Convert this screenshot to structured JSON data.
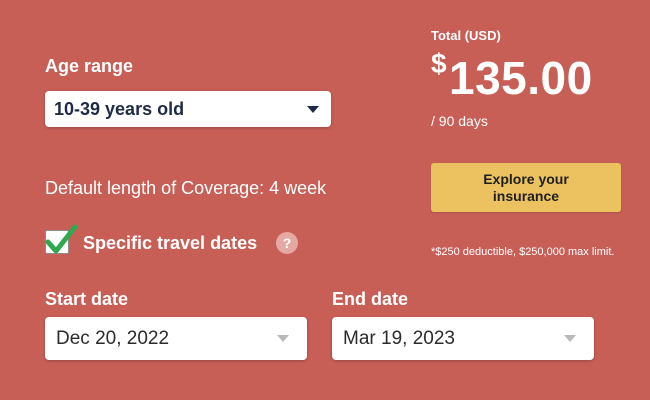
{
  "age_range": {
    "label": "Age range",
    "selected": "10-39 years old"
  },
  "coverage": {
    "text": "Default length of Coverage: 4 week"
  },
  "specific_dates": {
    "label": "Specific travel dates",
    "checked": true,
    "help_icon": "?"
  },
  "start_date": {
    "label": "Start date",
    "value": "Dec 20, 2022"
  },
  "end_date": {
    "label": "End date",
    "value": "Mar 19, 2023"
  },
  "total": {
    "label": "Total (USD)",
    "currency_symbol": "$",
    "amount": "135.00",
    "period": "/ 90 days"
  },
  "explore_button": {
    "label": "Explore your insurance"
  },
  "footnote": {
    "text": "*$250 deductible, $250,000 max limit."
  },
  "colors": {
    "background": "#c85f57",
    "button": "#ecc15f",
    "check": "#2fa84f"
  },
  "icons": [
    "chevron-down-icon",
    "checkmark-icon",
    "question-icon"
  ]
}
